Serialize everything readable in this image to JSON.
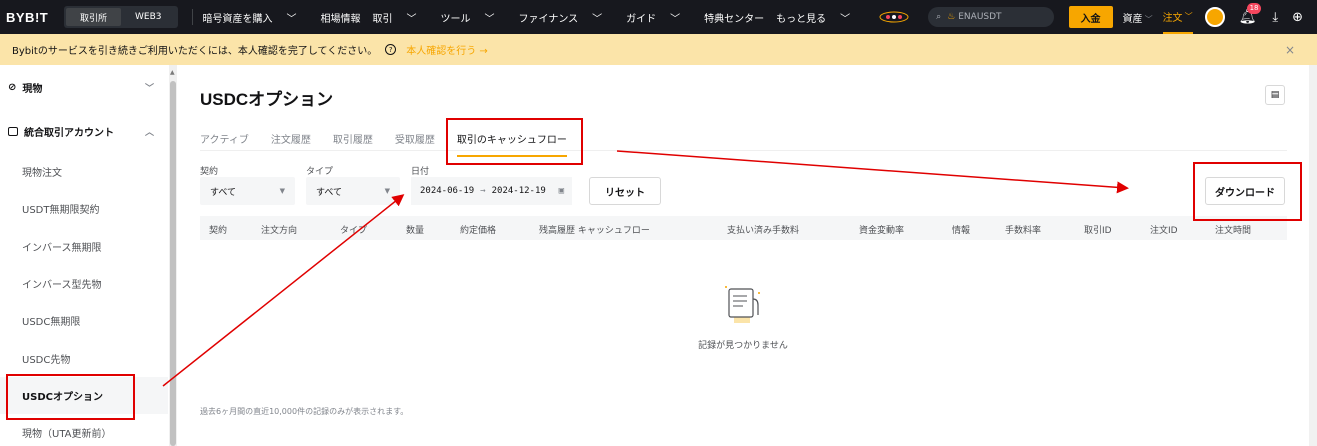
{
  "topnav": {
    "logo": "BYB!T",
    "seg_exchange": "取引所",
    "seg_web3": "WEB3",
    "menu": [
      "暗号資産を購入",
      "相場情報",
      "取引",
      "ツール",
      "ファイナンス",
      "ガイド",
      "特典センター",
      "もっと見る"
    ],
    "search_placeholder": "ENAUSDT",
    "deposit": "入金",
    "assets": "資産",
    "orders": "注文",
    "notifications_count": "18"
  },
  "banner": {
    "message": "Bybitのサービスを引き続きご利用いただくには、本人確認を完了してください。",
    "help_icon": "?",
    "link": "本人確認を行う →",
    "close": "×"
  },
  "sidebar": {
    "top_item": "現物",
    "group_label": "統合取引アカウント",
    "items": [
      {
        "label": "現物注文"
      },
      {
        "label": "USDT無期限契約"
      },
      {
        "label": "インバース無期限"
      },
      {
        "label": "インバース型先物"
      },
      {
        "label": "USDC無期限"
      },
      {
        "label": "USDC先物"
      },
      {
        "label": "USDCオプション"
      },
      {
        "label": "現物（UTA更新前）"
      }
    ]
  },
  "main": {
    "title": "USDCオプション",
    "tabs": [
      "アクティブ",
      "注文履歴",
      "取引履歴",
      "受取履歴",
      "取引のキャッシュフロー"
    ],
    "active_tab": "取引のキャッシュフロー",
    "filters": {
      "contract_label": "契約",
      "contract_value": "すべて",
      "type_label": "タイプ",
      "type_value": "すべて",
      "date_label": "日付",
      "date_from": "2024-06-19",
      "date_arrow": "→",
      "date_to": "2024-12-19"
    },
    "reset": "リセット",
    "download": "ダウンロード",
    "columns": [
      "契約",
      "注文方向",
      "タイプ",
      "数量",
      "約定価格",
      "残高履歴 キャッシュフロー",
      "支払い済み手数料",
      "資金変動率",
      "情報",
      "手数料率",
      "取引ID",
      "注文ID",
      "注文時間"
    ],
    "empty_text": "記録が見つかりません",
    "footnote": "過去6ヶ月間の直近10,000件の記録のみが表示されます。"
  },
  "colors": {
    "accent": "#f7a600",
    "annotation": "#e00000",
    "nav_bg": "#17181e",
    "banner_bg": "#fbe4a9"
  }
}
